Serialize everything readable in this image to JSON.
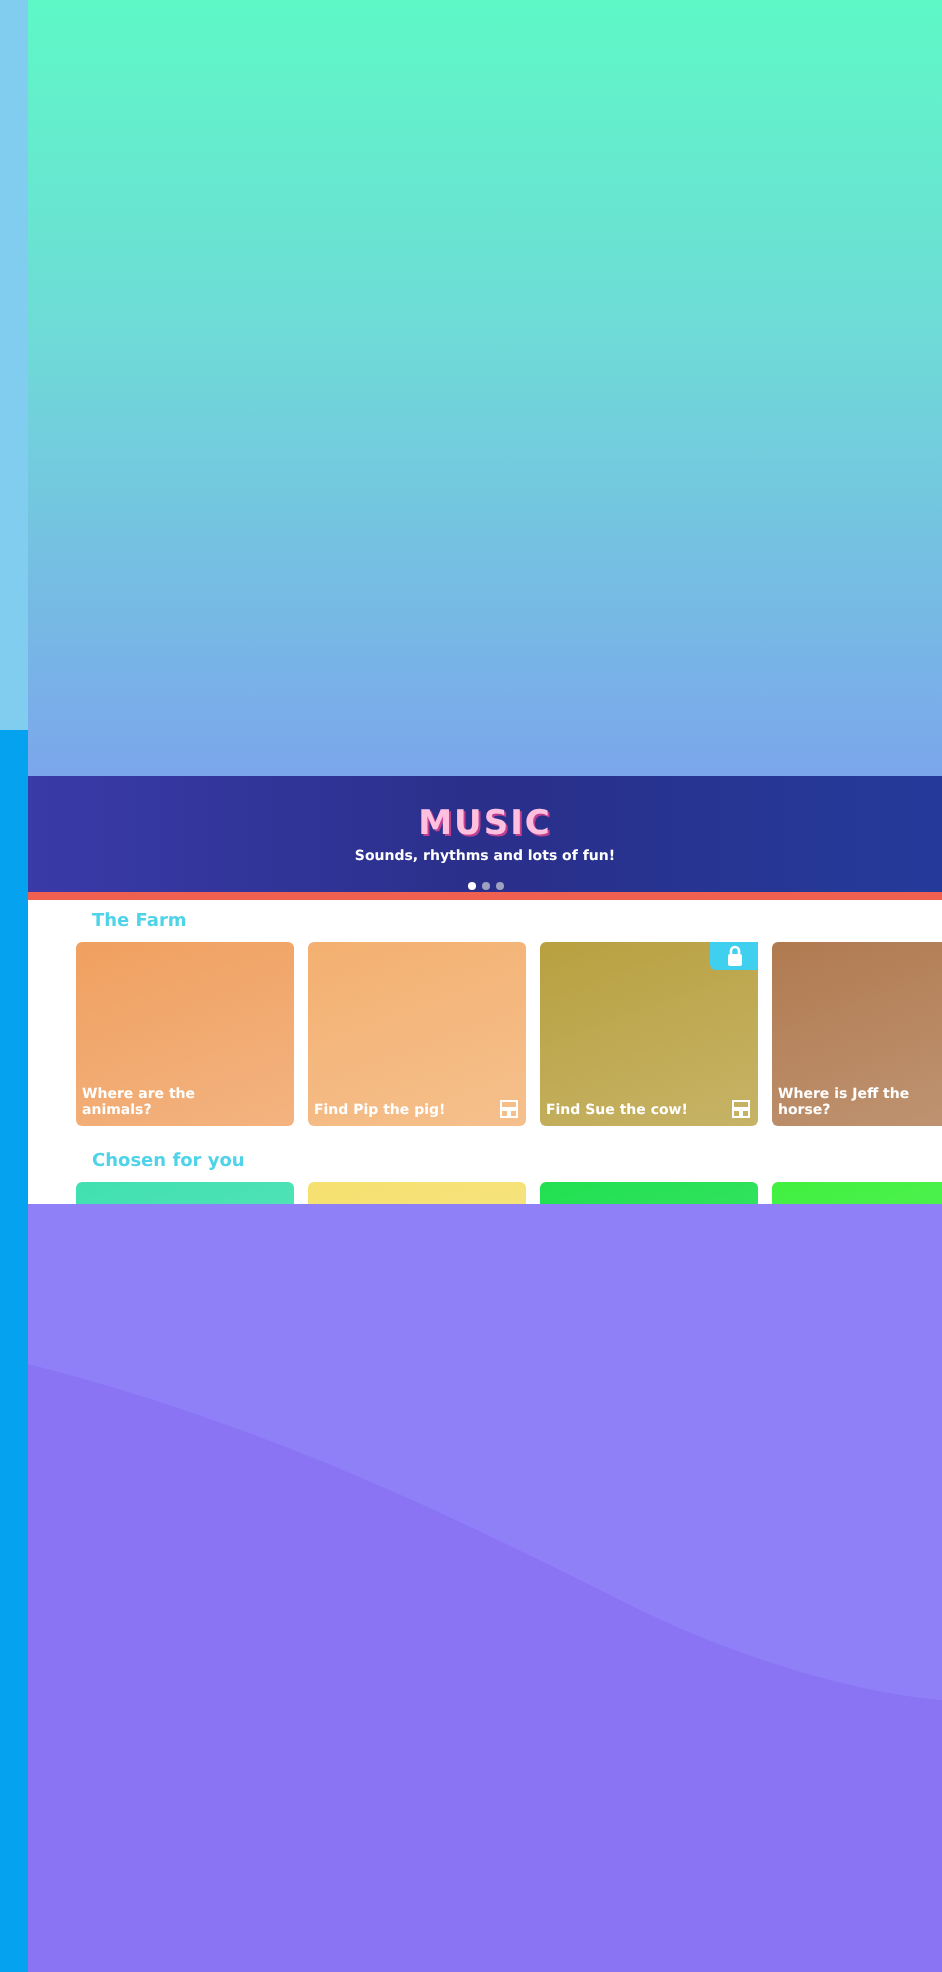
{
  "banner": {
    "logo": "MUSIC",
    "tagline": "Sounds, rhythms and lots of fun!",
    "dots": [
      {
        "selected": true
      },
      {
        "selected": false
      },
      {
        "selected": false
      }
    ]
  },
  "sections": [
    {
      "title": "The Farm",
      "cards": [
        {
          "title": "Where are the animals?",
          "locked": false,
          "ar_badge": false,
          "color": "#f0a060"
        },
        {
          "title": "Find Pip the pig!",
          "locked": false,
          "ar_badge": true,
          "color": "#f3b070"
        },
        {
          "title": "Find Sue the cow!",
          "locked": true,
          "ar_badge": true,
          "color": "#b8a040"
        },
        {
          "title": "Where is Jeff the horse?",
          "locked": false,
          "ar_badge": false,
          "color": "#b07a50"
        }
      ]
    },
    {
      "title": "Chosen for you",
      "cards": [
        {
          "locked": false,
          "ar_badge": false,
          "color": "#40e0b0"
        },
        {
          "locked": false,
          "ar_badge": false,
          "color": "#f5e070"
        },
        {
          "locked": false,
          "ar_badge": false,
          "color": "#20e050"
        },
        {
          "locked": false,
          "ar_badge": false,
          "color": "#40f040"
        }
      ]
    }
  ]
}
